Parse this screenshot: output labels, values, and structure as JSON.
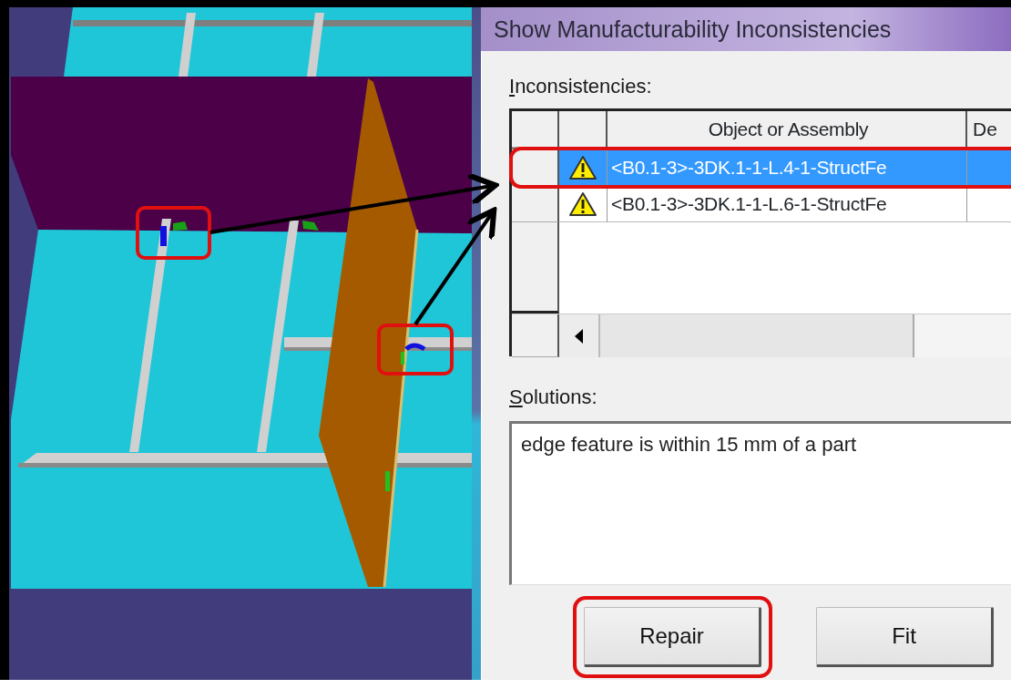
{
  "window": {
    "title": "Show Manufacturability Inconsistencies"
  },
  "inconsistencies": {
    "label": "Inconsistencies:",
    "columns": [
      "Object or Assembly",
      "De"
    ],
    "rows": [
      {
        "object": "<B0.1-3>-3DK.1-1-L.4-1-StructFe",
        "selected": true,
        "highlighted": true
      },
      {
        "object": "<B0.1-3>-3DK.1-1-L.6-1-StructFe",
        "selected": false,
        "highlighted": false
      }
    ]
  },
  "solutions": {
    "label": "Solutions:",
    "text": "edge feature is within 15 mm of a part"
  },
  "buttons": [
    {
      "label": "Repair",
      "highlighted": true
    },
    {
      "label": "Fit",
      "highlighted": false
    }
  ]
}
